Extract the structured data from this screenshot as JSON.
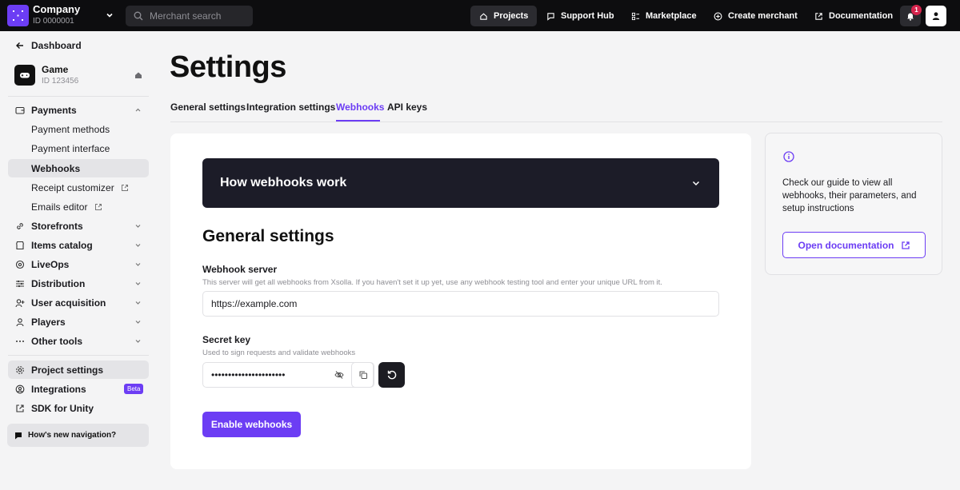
{
  "topbar": {
    "company_name": "Company",
    "company_id": "ID 0000001",
    "search_placeholder": "Merchant search",
    "nav": {
      "projects": "Projects",
      "support_hub": "Support Hub",
      "marketplace": "Marketplace",
      "create_merchant": "Create merchant",
      "documentation": "Documentation"
    },
    "notification_count": "1"
  },
  "sidebar": {
    "back_label": "Dashboard",
    "project": {
      "name": "Game",
      "id": "ID 123456"
    },
    "payments": {
      "label": "Payments",
      "items": [
        "Payment methods",
        "Payment interface",
        "Webhooks",
        "Receipt customizer",
        "Emails editor"
      ]
    },
    "sections": [
      "Storefronts",
      "Items catalog",
      "LiveOps",
      "Distribution",
      "User acquisition",
      "Players",
      "Other tools"
    ],
    "bottom": {
      "project_settings": "Project settings",
      "integrations": "Integrations",
      "beta_badge": "Beta",
      "sdk_unity": "SDK for Unity"
    },
    "whats_new": "How's new navigation?"
  },
  "main": {
    "title": "Settings",
    "tabs": [
      "General settings",
      "Integration settings",
      "Webhooks",
      "API keys"
    ],
    "active_tab": "Webhooks",
    "accordion_title": "How webhooks work",
    "section_title": "General settings",
    "webhook_server": {
      "label": "Webhook server",
      "help": "This server will get all webhooks from Xsolla. If you haven't set it up yet, use any webhook testing tool and enter your unique URL from it.",
      "value": "https://example.com"
    },
    "secret_key": {
      "label": "Secret key",
      "help": "Used to sign requests and validate webhooks",
      "value": "••••••••••••••••••••••"
    },
    "enable_button": "Enable webhooks"
  },
  "info_card": {
    "text": "Check our guide to view all webhooks, their parameters, and setup instructions",
    "button": "Open documentation"
  },
  "colors": {
    "accent": "#6c3df4",
    "topbar_bg": "#0d0d0f",
    "accordion_bg": "#1c1c28",
    "badge": "#d6244d"
  }
}
